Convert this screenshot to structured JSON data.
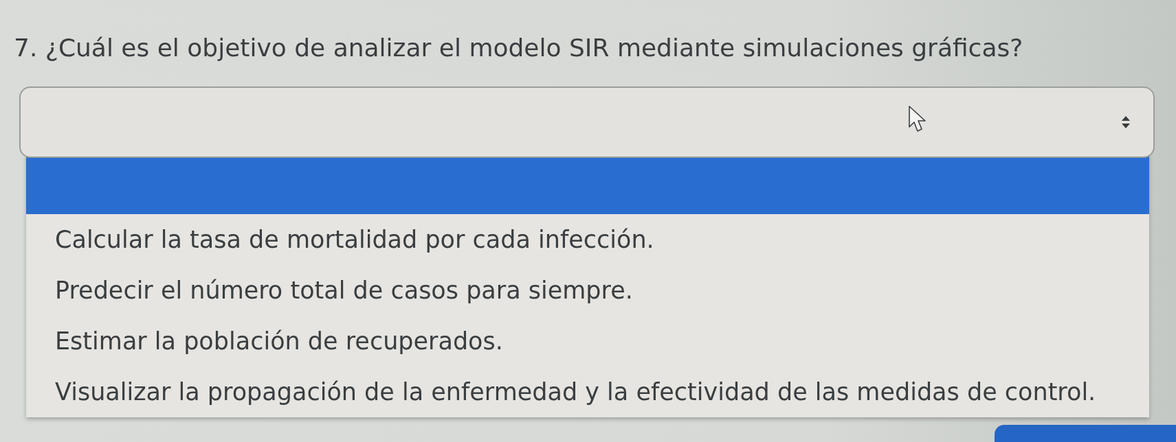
{
  "question": "7. ¿Cuál es el objetivo de analizar el modelo SIR mediante simulaciones gráficas?",
  "options": [
    {
      "selected": true
    },
    {
      "label": "Calcular la tasa de mortalidad por cada infección.",
      "selected": false
    },
    {
      "label": "Predecir el número total de casos para siempre.",
      "selected": false
    },
    {
      "label": "Estimar la población de recuperados.",
      "selected": false
    },
    {
      "label": "Visualizar la propagación de la enfermedad y la efectividad de las medidas de control.",
      "selected": false
    }
  ]
}
